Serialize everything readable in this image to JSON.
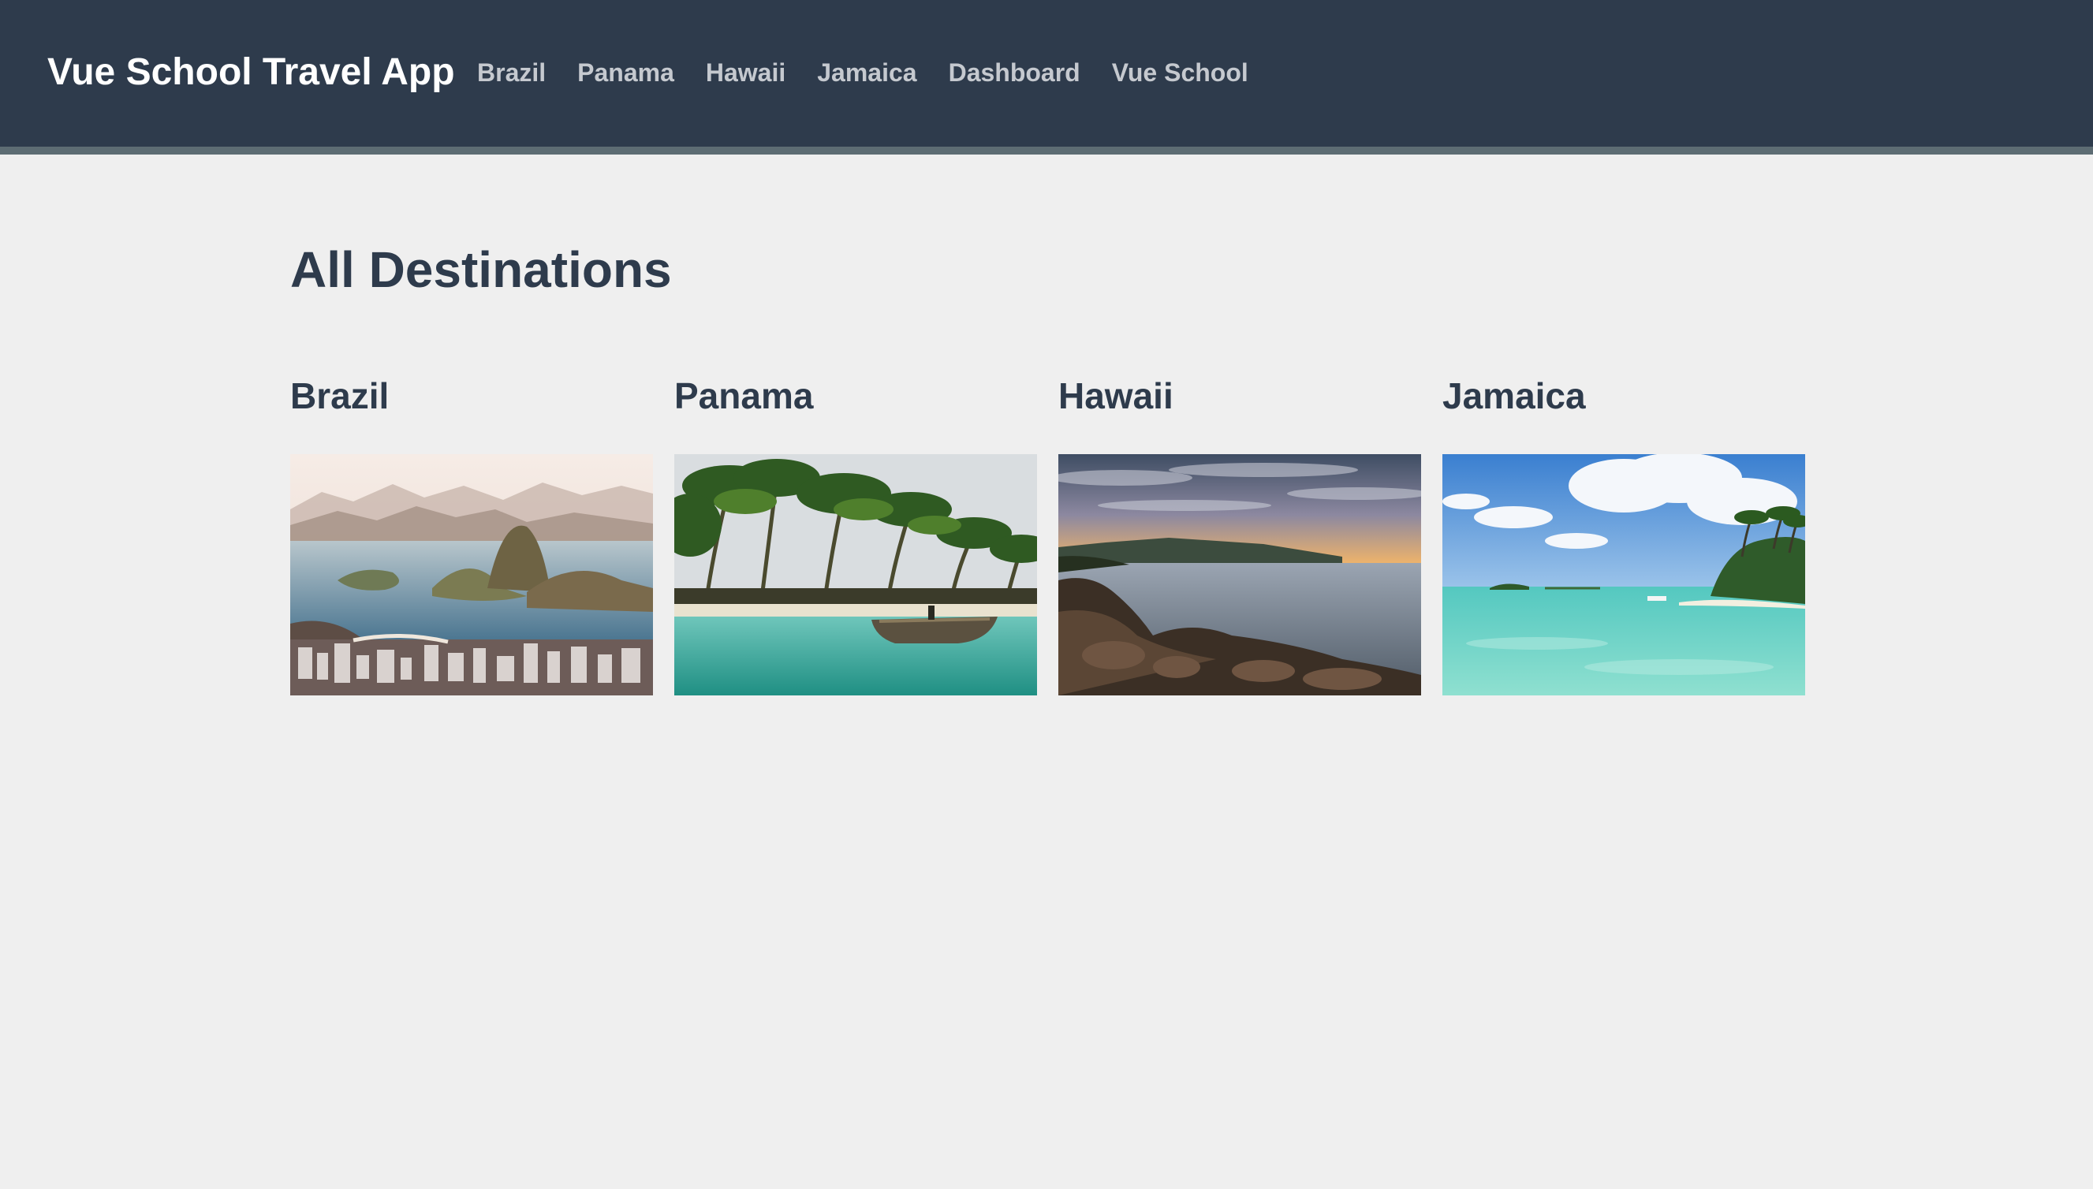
{
  "app": {
    "brand": "Vue School Travel App"
  },
  "nav": {
    "links": [
      {
        "label": "Brazil"
      },
      {
        "label": "Panama"
      },
      {
        "label": "Hawaii"
      },
      {
        "label": "Jamaica"
      },
      {
        "label": "Dashboard"
      },
      {
        "label": "Vue School"
      }
    ]
  },
  "main": {
    "title": "All Destinations",
    "destinations": [
      {
        "name": "Brazil",
        "image": "rio-de-janeiro-photo"
      },
      {
        "name": "Panama",
        "image": "palm-beach-canoe-photo"
      },
      {
        "name": "Hawaii",
        "image": "rocky-coast-sunset-photo"
      },
      {
        "name": "Jamaica",
        "image": "turquoise-lagoon-photo"
      }
    ]
  },
  "colors": {
    "navbar": "#2e3b4c",
    "navbar_border": "#5d6c73",
    "background": "#efefef",
    "heading": "#2e3b4c",
    "nav_link": "#c5c9cf",
    "brand": "#ffffff"
  }
}
